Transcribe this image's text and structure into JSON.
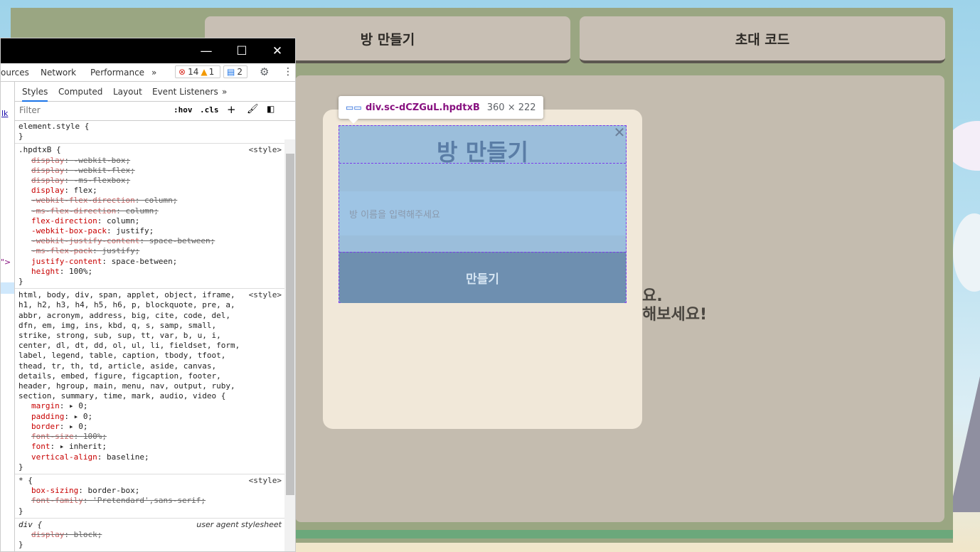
{
  "game": {
    "tab_create_room": "방 만들기",
    "tab_invite_code": "초대 코드",
    "bg_line1": "요.",
    "bg_line2": "해보세요!"
  },
  "modal": {
    "title": "방 만들기",
    "close_icon": "close-icon",
    "input_placeholder": "방 이름을 입력해주세요",
    "submit_label": "만들기"
  },
  "inspect_tooltip": {
    "selector": "div.sc-dCZGuL.hpdtxB",
    "size": "360 × 222"
  },
  "devtools": {
    "tabs": [
      "ources",
      "Network",
      "Performance",
      "»"
    ],
    "errors": "14",
    "warnings": "1",
    "messages": "2",
    "subtabs": [
      "Styles",
      "Computed",
      "Layout",
      "Event Listeners",
      "»"
    ],
    "filter_placeholder": "Filter",
    "hov": ":hov",
    "cls": ".cls",
    "left_snippets": {
      "lk": "lk",
      "gt": "\">"
    },
    "rules": {
      "element_style": {
        "selector": "element.style {",
        "close": "}"
      },
      "hpdtxB": {
        "selector": ".hpdtxB {",
        "source": "<style>",
        "props": [
          {
            "name": "display",
            "value": "-webkit-box;",
            "struck": true
          },
          {
            "name": "display",
            "value": "-webkit-flex;",
            "struck": true
          },
          {
            "name": "display",
            "value": "-ms-flexbox;",
            "struck": true
          },
          {
            "name": "display",
            "value": "flex;",
            "struck": false
          },
          {
            "name": "-webkit-flex-direction",
            "value": "column;",
            "struck": true
          },
          {
            "name": "-ms-flex-direction",
            "value": "column;",
            "struck": true
          },
          {
            "name": "flex-direction",
            "value": "column;",
            "struck": false
          },
          {
            "name": "-webkit-box-pack",
            "value": "justify;",
            "struck": false
          },
          {
            "name": "-webkit-justify-content",
            "value": "space-between;",
            "struck": true
          },
          {
            "name": "-ms-flex-pack",
            "value": "justify;",
            "struck": true
          },
          {
            "name": "justify-content",
            "value": "space-between;",
            "struck": false
          },
          {
            "name": "height",
            "value": "100%;",
            "struck": false
          }
        ],
        "close": "}"
      },
      "reset": {
        "selector": "html, body, div, span, applet, object, iframe, h1, h2, h3, h4, h5, h6, p, blockquote, pre, a, abbr, acronym, address, big, cite, code, del, dfn, em, img, ins, kbd, q, s, samp, small, strike, strong, sub, sup, tt, var, b, u, i, center, dl, dt, dd, ol, ul, li, fieldset, form, label, legend, table, caption, tbody, tfoot, thead, tr, th, td, article, aside, canvas, details, embed, figure, figcaption, footer, header, hgroup, main, menu, nav, output, ruby, section, summary, time, mark, audio, video {",
        "source": "<style>",
        "props": [
          {
            "name": "margin",
            "value": "▸ 0;",
            "struck": false
          },
          {
            "name": "padding",
            "value": "▸ 0;",
            "struck": false
          },
          {
            "name": "border",
            "value": "▸ 0;",
            "struck": false
          },
          {
            "name": "font-size",
            "value": "100%;",
            "struck": true
          },
          {
            "name": "font",
            "value": "▸ inherit;",
            "struck": false
          },
          {
            "name": "vertical-align",
            "value": "baseline;",
            "struck": false
          }
        ],
        "close": "}"
      },
      "universal": {
        "selector": "* {",
        "source": "<style>",
        "props": [
          {
            "name": "box-sizing",
            "value": "border-box;",
            "struck": false
          },
          {
            "name": "font-family",
            "value": "'Pretendard',sans-serif;",
            "struck": true
          }
        ],
        "close": "}"
      },
      "ua_div": {
        "selector": "div {",
        "source": "user agent stylesheet",
        "props": [
          {
            "name": "display",
            "value": "block;",
            "struck": true
          }
        ],
        "close": "}"
      }
    }
  }
}
